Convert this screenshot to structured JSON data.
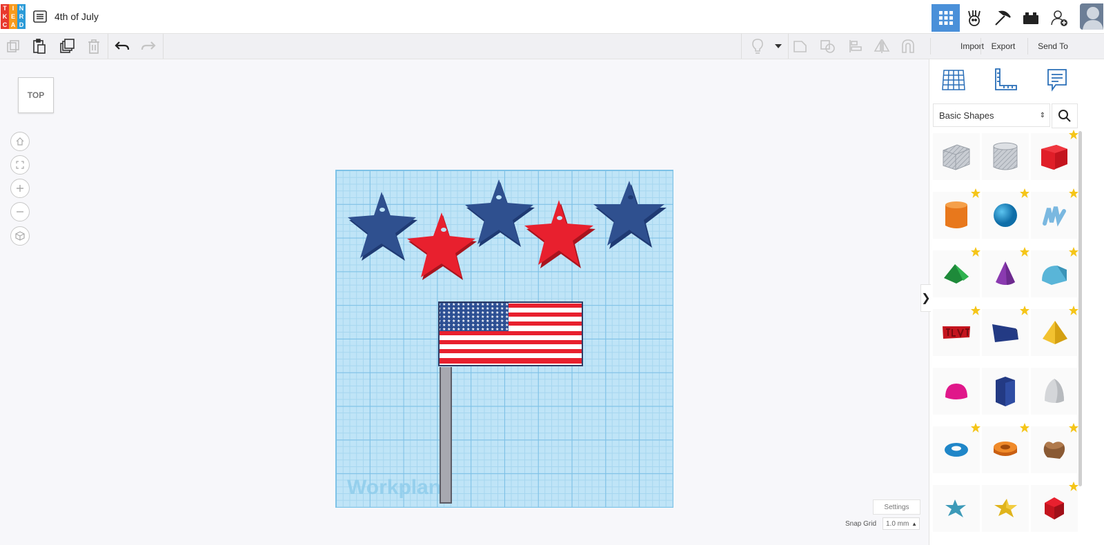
{
  "app": {
    "logo_letters": [
      "T",
      "I",
      "N",
      "K",
      "E",
      "R",
      "C",
      "A",
      "D"
    ],
    "logo_colors": [
      "#e8382d",
      "#f89a1c",
      "#2b9bd8",
      "#e8382d",
      "#f89a1c",
      "#2b9bd8",
      "#e8382d",
      "#f89a1c",
      "#2b9bd8"
    ],
    "design_title": "4th of July"
  },
  "header": {
    "icons": [
      {
        "name": "3d-design-grid-icon",
        "active": true
      },
      {
        "name": "circuits-icon",
        "active": false
      },
      {
        "name": "pickaxe-codeblocks-icon",
        "active": false
      },
      {
        "name": "lego-bricks-icon",
        "active": false
      },
      {
        "name": "add-user-icon",
        "active": false
      }
    ]
  },
  "toolbar": {
    "left": [
      "copy-icon",
      "paste-icon",
      "duplicate-icon",
      "delete-icon",
      "undo-icon",
      "redo-icon"
    ],
    "right": [
      "light-bulb-icon",
      "dropdown-caret-icon",
      "group-icon",
      "ungroup-icon",
      "align-icon",
      "mirror-icon",
      "magnet-icon"
    ],
    "import_label": "Import",
    "export_label": "Export",
    "send_to_label": "Send To"
  },
  "viewcube": {
    "label": "TOP"
  },
  "nav_buttons": [
    "home-view-icon",
    "fit-view-icon",
    "zoom-in-icon",
    "zoom-out-icon",
    "ortho-view-icon"
  ],
  "workplane": {
    "label": "Workplane"
  },
  "bottom": {
    "settings_label": "Settings",
    "snap_grid_label": "Snap Grid",
    "snap_grid_value": "1.0 mm"
  },
  "right_panel": {
    "top_icons": [
      "workplane-grid-icon",
      "ruler-icon",
      "notes-icon"
    ],
    "category": "Basic Shapes",
    "collapse_symbol": "❯",
    "shapes": [
      {
        "name": "box-hole",
        "fav": false
      },
      {
        "name": "cylinder-hole",
        "fav": false
      },
      {
        "name": "box",
        "fav": true
      },
      {
        "name": "cylinder",
        "fav": true
      },
      {
        "name": "sphere",
        "fav": true
      },
      {
        "name": "scribble",
        "fav": true
      },
      {
        "name": "roof",
        "fav": true
      },
      {
        "name": "cone",
        "fav": true
      },
      {
        "name": "round-roof",
        "fav": true
      },
      {
        "name": "text",
        "fav": true
      },
      {
        "name": "wedge",
        "fav": true
      },
      {
        "name": "pyramid",
        "fav": true
      },
      {
        "name": "half-sphere",
        "fav": false
      },
      {
        "name": "polygon",
        "fav": false
      },
      {
        "name": "paraboloid",
        "fav": false
      },
      {
        "name": "torus",
        "fav": true
      },
      {
        "name": "tube",
        "fav": true
      },
      {
        "name": "heart",
        "fav": true
      },
      {
        "name": "star",
        "fav": false
      },
      {
        "name": "star-gold",
        "fav": false
      },
      {
        "name": "icosahedron",
        "fav": true
      }
    ]
  },
  "colors": {
    "accent": "#4a90d9",
    "star_blue": "#2f4f8f",
    "star_red": "#e8202e",
    "workplane": "#bfe4f7"
  }
}
